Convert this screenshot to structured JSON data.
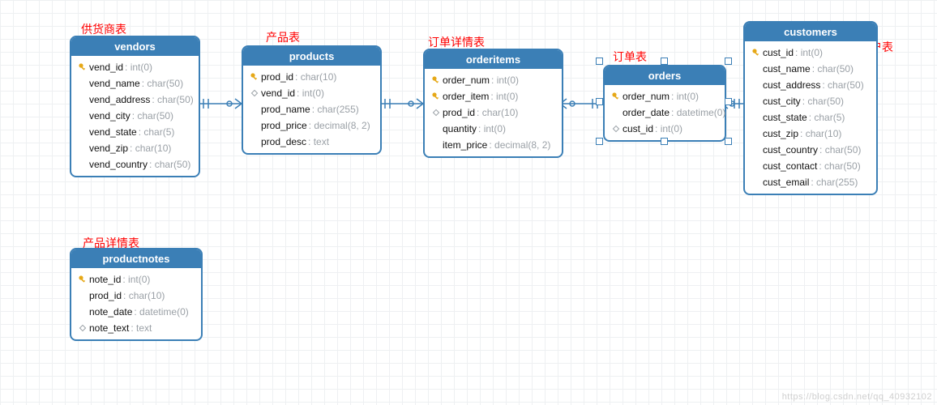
{
  "annotations": {
    "vendors": "供货商表",
    "products": "产品表",
    "orderitems": "订单详情表",
    "orders": "订单表",
    "customers": "用户表",
    "productnotes": "产品详情表"
  },
  "entities": {
    "vendors": {
      "title": "vendors",
      "columns": [
        {
          "icon": "key",
          "name": "vend_id",
          "type": "int(0)"
        },
        {
          "icon": "",
          "name": "vend_name",
          "type": "char(50)"
        },
        {
          "icon": "",
          "name": "vend_address",
          "type": "char(50)"
        },
        {
          "icon": "",
          "name": "vend_city",
          "type": "char(50)"
        },
        {
          "icon": "",
          "name": "vend_state",
          "type": "char(5)"
        },
        {
          "icon": "",
          "name": "vend_zip",
          "type": "char(10)"
        },
        {
          "icon": "",
          "name": "vend_country",
          "type": "char(50)"
        }
      ]
    },
    "products": {
      "title": "products",
      "columns": [
        {
          "icon": "key",
          "name": "prod_id",
          "type": "char(10)"
        },
        {
          "icon": "diamond",
          "name": "vend_id",
          "type": "int(0)"
        },
        {
          "icon": "",
          "name": "prod_name",
          "type": "char(255)"
        },
        {
          "icon": "",
          "name": "prod_price",
          "type": "decimal(8, 2)"
        },
        {
          "icon": "",
          "name": "prod_desc",
          "type": "text"
        }
      ]
    },
    "orderitems": {
      "title": "orderitems",
      "columns": [
        {
          "icon": "key",
          "name": "order_num",
          "type": "int(0)"
        },
        {
          "icon": "key",
          "name": "order_item",
          "type": "int(0)"
        },
        {
          "icon": "diamond",
          "name": "prod_id",
          "type": "char(10)"
        },
        {
          "icon": "",
          "name": "quantity",
          "type": "int(0)"
        },
        {
          "icon": "",
          "name": "item_price",
          "type": "decimal(8, 2)"
        }
      ]
    },
    "orders": {
      "title": "orders",
      "columns": [
        {
          "icon": "key",
          "name": "order_num",
          "type": "int(0)"
        },
        {
          "icon": "",
          "name": "order_date",
          "type": "datetime(0)"
        },
        {
          "icon": "diamond",
          "name": "cust_id",
          "type": "int(0)"
        }
      ]
    },
    "customers": {
      "title": "customers",
      "columns": [
        {
          "icon": "key",
          "name": "cust_id",
          "type": "int(0)"
        },
        {
          "icon": "",
          "name": "cust_name",
          "type": "char(50)"
        },
        {
          "icon": "",
          "name": "cust_address",
          "type": "char(50)"
        },
        {
          "icon": "",
          "name": "cust_city",
          "type": "char(50)"
        },
        {
          "icon": "",
          "name": "cust_state",
          "type": "char(5)"
        },
        {
          "icon": "",
          "name": "cust_zip",
          "type": "char(10)"
        },
        {
          "icon": "",
          "name": "cust_country",
          "type": "char(50)"
        },
        {
          "icon": "",
          "name": "cust_contact",
          "type": "char(50)"
        },
        {
          "icon": "",
          "name": "cust_email",
          "type": "char(255)"
        }
      ]
    },
    "productnotes": {
      "title": "productnotes",
      "columns": [
        {
          "icon": "key",
          "name": "note_id",
          "type": "int(0)"
        },
        {
          "icon": "",
          "name": "prod_id",
          "type": "char(10)"
        },
        {
          "icon": "",
          "name": "note_date",
          "type": "datetime(0)"
        },
        {
          "icon": "diamond",
          "name": "note_text",
          "type": "text"
        }
      ]
    }
  },
  "relationships": [
    {
      "from": "vendors.vend_id",
      "to": "products.vend_id",
      "type": "one-to-many"
    },
    {
      "from": "products.prod_id",
      "to": "orderitems.prod_id",
      "type": "one-to-many"
    },
    {
      "from": "orders.order_num",
      "to": "orderitems.order_num",
      "type": "one-to-many"
    },
    {
      "from": "customers.cust_id",
      "to": "orders.cust_id",
      "type": "one-to-many"
    }
  ],
  "watermark": "https://blog.csdn.net/qq_40932102"
}
